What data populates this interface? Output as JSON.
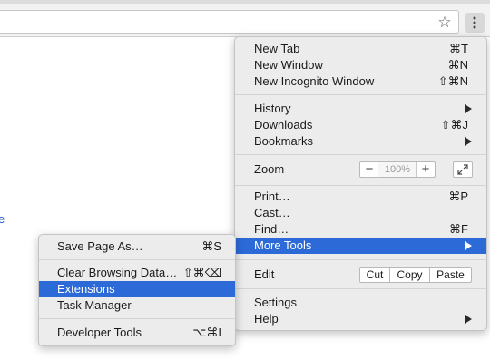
{
  "toolbar": {
    "star_glyph": "☆",
    "page_link_text": "e"
  },
  "main_menu": {
    "new_tab": {
      "label": "New Tab",
      "shortcut": "⌘T"
    },
    "new_window": {
      "label": "New Window",
      "shortcut": "⌘N"
    },
    "new_incognito": {
      "label": "New Incognito Window",
      "shortcut": "⇧⌘N"
    },
    "history": {
      "label": "History"
    },
    "downloads": {
      "label": "Downloads",
      "shortcut": "⇧⌘J"
    },
    "bookmarks": {
      "label": "Bookmarks"
    },
    "zoom": {
      "label": "Zoom",
      "minus": "−",
      "value": "100%",
      "plus": "+"
    },
    "print": {
      "label": "Print…",
      "shortcut": "⌘P"
    },
    "cast": {
      "label": "Cast…"
    },
    "find": {
      "label": "Find…",
      "shortcut": "⌘F"
    },
    "more_tools": {
      "label": "More Tools"
    },
    "edit": {
      "label": "Edit",
      "cut": "Cut",
      "copy": "Copy",
      "paste": "Paste"
    },
    "settings": {
      "label": "Settings"
    },
    "help": {
      "label": "Help"
    }
  },
  "sub_menu": {
    "save_page_as": {
      "label": "Save Page As…",
      "shortcut": "⌘S"
    },
    "clear_browsing_data": {
      "label": "Clear Browsing Data…",
      "shortcut": "⇧⌘⌫"
    },
    "extensions": {
      "label": "Extensions"
    },
    "task_manager": {
      "label": "Task Manager"
    },
    "developer_tools": {
      "label": "Developer Tools",
      "shortcut": "⌥⌘I"
    }
  },
  "colors": {
    "highlight": "#2c6ad8",
    "menu_background": "#ececec",
    "link": "#2962c9"
  }
}
